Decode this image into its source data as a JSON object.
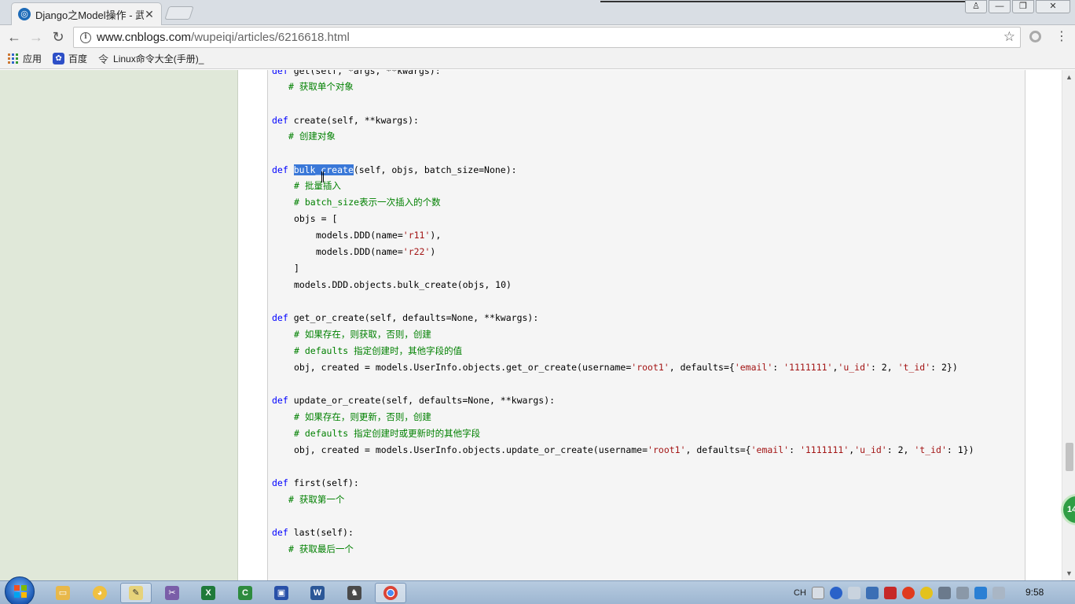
{
  "browser": {
    "tab": {
      "title": "Django之Model操作 - 武",
      "favicon": "cnblogs-icon",
      "close": "✕"
    },
    "window_controls": [
      "user-icon",
      "minimize-icon",
      "restore-icon",
      "close-icon"
    ],
    "address": {
      "host": "www.cnblogs.com",
      "path": "/wupeiqi/articles/6216618.html"
    },
    "bookmarks": [
      {
        "label": "应用",
        "icon": "apps-grid-icon"
      },
      {
        "label": "百度",
        "icon": "baidu-paw-icon"
      },
      {
        "label": "Linux命令大全(手册)_",
        "icon": "command-icon"
      }
    ]
  },
  "code": {
    "l1_def": "def ",
    "l1_rest": "get(self, *args, **kwargs):",
    "l2": "# 获取单个对象",
    "l3_def": "def ",
    "l3_rest": "create(self, **kwargs):",
    "l4": "# 创建对象",
    "l5_def": "def ",
    "l5_sel": "bulk_create",
    "l5_rest": "(self, objs, batch_size=None):",
    "l6": "# 批量插入",
    "l7": "# batch_size表示一次插入的个数",
    "l8": "objs = [",
    "l9_a": "models.DDD(name=",
    "l9_s": "'r11'",
    "l9_b": "),",
    "l10_a": "models.DDD(name=",
    "l10_s": "'r22'",
    "l10_b": ")",
    "l11": "]",
    "l12": "models.DDD.objects.bulk_create(objs, 10)",
    "l13_def": "def ",
    "l13_rest": "get_or_create(self, defaults=None, **kwargs):",
    "l14": "# 如果存在，则获取，否则，创建",
    "l15": "# defaults 指定创建时，其他字段的值",
    "l16_a": "obj, created = models.UserInfo.objects.get_or_create(username=",
    "l16_s1": "'root1'",
    "l16_b": ", defaults={",
    "l16_s2": "'email'",
    "l16_c": ": ",
    "l16_s3": "'1111111'",
    "l16_d": ",",
    "l16_s4": "'u_id'",
    "l16_e": ": 2, ",
    "l16_s5": "'t_id'",
    "l16_f": ": 2})",
    "l17_def": "def ",
    "l17_rest": "update_or_create(self, defaults=None, **kwargs):",
    "l18": "# 如果存在，则更新，否则，创建",
    "l19": "# defaults 指定创建时或更新时的其他字段",
    "l20_a": "obj, created = models.UserInfo.objects.update_or_create(username=",
    "l20_s1": "'root1'",
    "l20_b": ", defaults={",
    "l20_s2": "'email'",
    "l20_c": ": ",
    "l20_s3": "'1111111'",
    "l20_d": ",",
    "l20_s4": "'u_id'",
    "l20_e": ": 2, ",
    "l20_s5": "'t_id'",
    "l20_f": ": 1})",
    "l21_def": "def ",
    "l21_rest": "first(self):",
    "l22": "# 获取第一个",
    "l23_def": "def ",
    "l23_rest": "last(self):",
    "l24": "# 获取最后一个"
  },
  "float_badge": "14",
  "taskbar": {
    "apps": [
      "file-explorer-icon",
      "paint-icon",
      "notepad-icon",
      "tool-icon",
      "excel-icon",
      "camtasia-icon",
      "save-icon",
      "word-icon",
      "chess-icon",
      "chrome-icon"
    ],
    "tray_lang": "CH",
    "clock": "9:58"
  },
  "colors": {
    "keyword": "#0000ff",
    "comment": "#008000",
    "string": "#a31515",
    "selection": "#3a78d8",
    "sidebar": "#e0e8d9"
  }
}
